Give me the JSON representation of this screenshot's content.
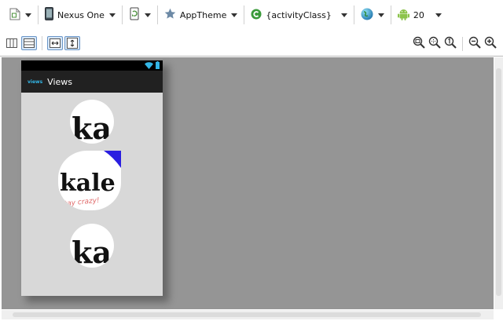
{
  "toolbar": {
    "device": "Nexus One",
    "theme": "AppTheme",
    "activity": "{activityClass}",
    "api_level": "20"
  },
  "app": {
    "logo_text": "views",
    "title": "Views"
  },
  "images": {
    "text_small": "ka",
    "text_big": "kale",
    "tagline": "Stay crazy!"
  },
  "colors": {
    "canvas": "#959595",
    "device_bg": "#d8d8d8",
    "actionbar": "#212121",
    "accent": "#33b5e5"
  }
}
